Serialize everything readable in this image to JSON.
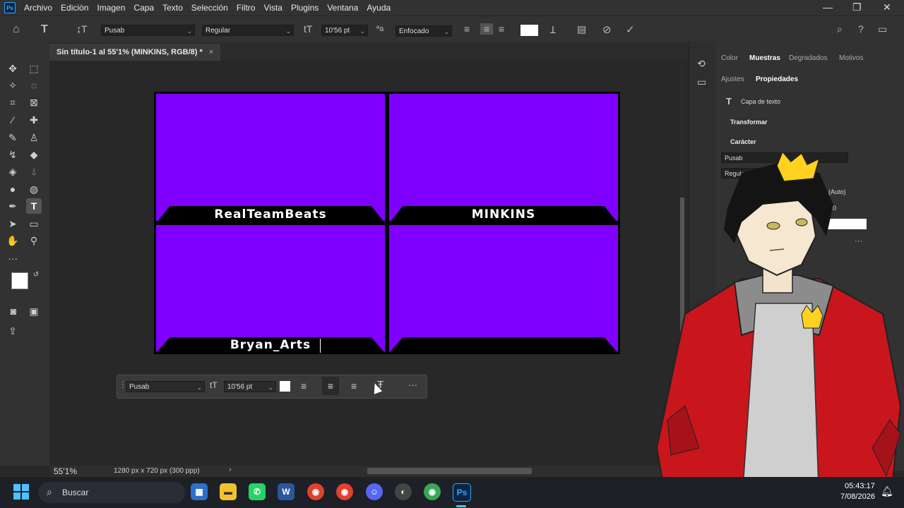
{
  "menu": {
    "app_logo": "Ps",
    "items": [
      "Archivo",
      "Edición",
      "Imagen",
      "Capa",
      "Texto",
      "Selección",
      "Filtro",
      "Vista",
      "Plugins",
      "Ventana",
      "Ayuda"
    ]
  },
  "window_controls": {
    "minimize": "—",
    "restore": "❐",
    "close": "✕"
  },
  "options_bar": {
    "font_family": "Pusab",
    "font_style": "Regular",
    "font_size": "10'56 pt",
    "antialias": "Enfocado",
    "icons": [
      "home-icon",
      "text-tool-icon",
      "text-orientation-icon",
      "font-size-icon",
      "antialias-icon",
      "align-left-icon",
      "align-center-icon",
      "align-right-icon",
      "color-swatch",
      "warp-text-icon",
      "character-panel-icon",
      "cancel-icon",
      "commit-icon",
      "search-icon",
      "help-icon",
      "workspace-icon"
    ]
  },
  "document": {
    "tab_title": "Sin título-1 al 55'1% (MINKINS, RGB/8) *",
    "zoom": "55'1%",
    "doc_info": "1280 px x 720 px (300 ppp)"
  },
  "artboard": {
    "panel_color": "#8000ff",
    "labels": [
      "RealTeamBeats",
      "MINKINS",
      "Bryan_Arts",
      ""
    ]
  },
  "float_toolbar": {
    "font_family": "Pusab",
    "font_size": "10'56 pt",
    "more": "···"
  },
  "right_panel": {
    "top_tabs": [
      "Color",
      "Muestras",
      "Degradados",
      "Motivos"
    ],
    "active_top_tab": "Muestras",
    "sub_tabs": [
      "Ajustes",
      "Propiedades"
    ],
    "active_sub_tab": "Propiedades",
    "layer_type": "Capa de texto",
    "section_transform": "Transformar",
    "section_character": "Carácter",
    "char_font": "Pusab",
    "char_style": "Regular",
    "leading": "(Auto)",
    "tracking": "20",
    "more": "···"
  },
  "taskbar": {
    "search_placeholder": "Buscar",
    "time": "05:43:17",
    "date": "7/08/2026"
  }
}
